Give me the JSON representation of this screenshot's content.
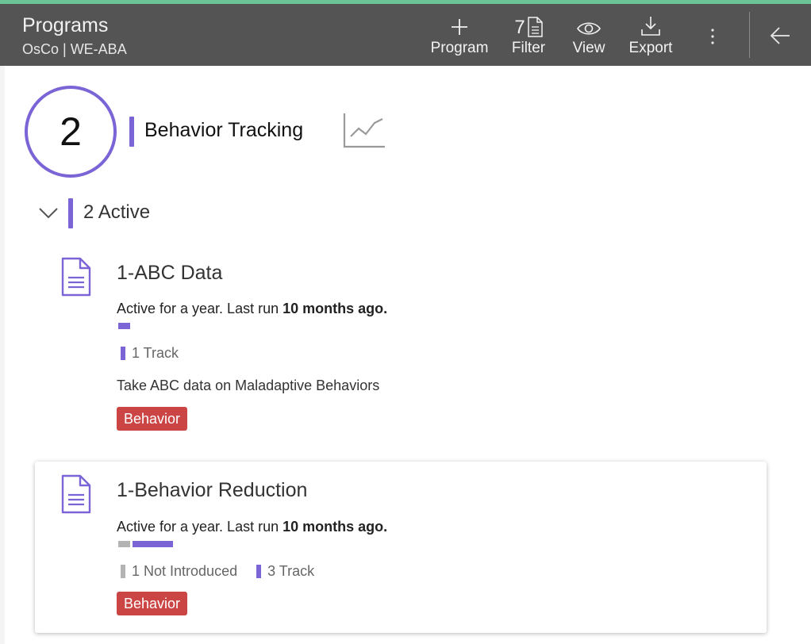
{
  "colors": {
    "accent": "#6cc396",
    "header_bg": "#545454",
    "purple": "#7a64d6",
    "gray": "#b3b3b3",
    "tag_red": "#cc4545"
  },
  "header": {
    "title": "Programs",
    "subtitle": "OsCo | WE-ABA",
    "toolbar": {
      "program_label": "Program",
      "filter_count": "7",
      "filter_label": "Filter",
      "view_label": "View",
      "export_label": "Export"
    },
    "icons": [
      "plus-icon",
      "document-icon",
      "eye-icon",
      "download-icon",
      "more-vertical-icon",
      "arrow-left-icon"
    ]
  },
  "group": {
    "count": "2",
    "title": "Behavior Tracking",
    "active_label": "2 Active"
  },
  "programs": [
    {
      "name": "1-ABC Data",
      "status_prefix": "Active for a year. Last run ",
      "status_bold": "10 months ago.",
      "progress": [
        {
          "status": "Track",
          "count": 1,
          "color": "#7a64d6"
        }
      ],
      "legend": [
        {
          "text": "1 Track",
          "color": "#7a64d6"
        }
      ],
      "description": "Take ABC data on Maladaptive Behaviors",
      "tag": "Behavior"
    },
    {
      "name": "1-Behavior Reduction",
      "status_prefix": "Active for a year. Last run ",
      "status_bold": "10 months ago.",
      "progress": [
        {
          "status": "Not Introduced",
          "count": 1,
          "color": "#b3b3b3"
        },
        {
          "status": "Track",
          "count": 3,
          "color": "#7a64d6"
        }
      ],
      "legend": [
        {
          "text": "1 Not Introduced",
          "color": "#b3b3b3"
        },
        {
          "text": "3 Track",
          "color": "#7a64d6"
        }
      ],
      "description": "",
      "tag": "Behavior"
    }
  ]
}
